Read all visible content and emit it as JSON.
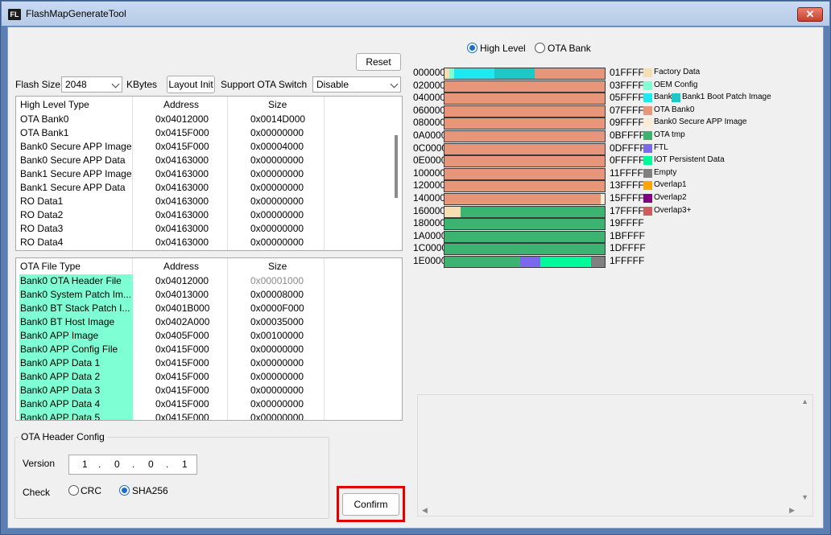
{
  "window": {
    "title": "FlashMapGenerateTool",
    "icon_text": "FL",
    "close_label": "✕"
  },
  "toolbar": {
    "reset_label": "Reset",
    "flash_size_label": "Flash Size",
    "flash_size_value": "2048",
    "kbytes_label": "KBytes",
    "layout_init_label": "Layout Init",
    "ota_switch_label": "Support OTA Switch",
    "ota_switch_value": "Disable"
  },
  "high_level_table": {
    "headers": [
      "High Level Type",
      "Address",
      "Size"
    ],
    "rows": [
      [
        "OTA Bank0",
        "0x04012000",
        "0x0014D000"
      ],
      [
        "OTA Bank1",
        "0x0415F000",
        "0x00000000"
      ],
      [
        "Bank0 Secure APP Image",
        "0x0415F000",
        "0x00004000"
      ],
      [
        "Bank0 Secure APP Data",
        "0x04163000",
        "0x00000000"
      ],
      [
        "Bank1 Secure APP Image",
        "0x04163000",
        "0x00000000"
      ],
      [
        "Bank1 Secure APP Data",
        "0x04163000",
        "0x00000000"
      ],
      [
        "RO Data1",
        "0x04163000",
        "0x00000000"
      ],
      [
        "RO Data2",
        "0x04163000",
        "0x00000000"
      ],
      [
        "RO Data3",
        "0x04163000",
        "0x00000000"
      ],
      [
        "RO Data4",
        "0x04163000",
        "0x00000000"
      ]
    ]
  },
  "ota_file_table": {
    "headers": [
      "OTA File Type",
      "Address",
      "Size"
    ],
    "rows": [
      [
        "Bank0 OTA Header File",
        "0x04012000",
        "0x00001000"
      ],
      [
        "Bank0 System Patch Im...",
        "0x04013000",
        "0x00008000"
      ],
      [
        "Bank0 BT Stack Patch I...",
        "0x0401B000",
        "0x0000F000"
      ],
      [
        "Bank0 BT Host Image",
        "0x0402A000",
        "0x00035000"
      ],
      [
        "Bank0 APP Image",
        "0x0405F000",
        "0x00100000"
      ],
      [
        "Bank0 APP Config File",
        "0x0415F000",
        "0x00000000"
      ],
      [
        "Bank0 APP Data 1",
        "0x0415F000",
        "0x00000000"
      ],
      [
        "Bank0 APP Data 2",
        "0x0415F000",
        "0x00000000"
      ],
      [
        "Bank0 APP Data 3",
        "0x0415F000",
        "0x00000000"
      ],
      [
        "Bank0 APP Data 4",
        "0x0415F000",
        "0x00000000"
      ],
      [
        "Bank0 APP Data 5",
        "0x0415F000",
        "0x00000000"
      ]
    ]
  },
  "ota_header": {
    "group_title": "OTA Header Config",
    "version_label": "Version",
    "version_parts": [
      "1",
      ".",
      "0",
      ".",
      "0",
      ".",
      "1"
    ],
    "check_label": "Check",
    "crc_label": "CRC",
    "sha_label": "SHA256",
    "selected": "SHA256"
  },
  "confirm_label": "Confirm",
  "view_mode": {
    "high_level_label": "High Level",
    "ota_bank_label": "OTA Bank",
    "selected": "High Level"
  },
  "flash_map": {
    "left_addrs": [
      "000000",
      "020000",
      "040000",
      "060000",
      "080000",
      "0A0000",
      "0C0000",
      "0E0000",
      "100000",
      "120000",
      "140000",
      "160000",
      "180000",
      "1A0000",
      "1C0000",
      "1E0000"
    ],
    "right_addrs": [
      "01FFFF",
      "03FFFF",
      "05FFFF",
      "07FFFF",
      "09FFFF",
      "0BFFFF",
      "0DFFFF",
      "0FFFFF",
      "11FFFF",
      "13FFFF",
      "15FFFF",
      "17FFFF",
      "19FFFF",
      "1BFFFF",
      "1DFFFF",
      "1FFFFF"
    ]
  },
  "legend": [
    {
      "label": "Factory Data",
      "color": "#f5deb3"
    },
    {
      "label": "OEM Config",
      "color": "#7fffd4"
    },
    {
      "label": "Bank",
      "color": "#1ee8f0",
      "extra_label": "Bank1 Boot Patch Image",
      "extra_color": "#1ec8c8"
    },
    {
      "label": "OTA Bank0",
      "color": "#e8967a"
    },
    {
      "label": "Bank0 Secure APP Image",
      "color": "#faebd7"
    },
    {
      "label": "OTA tmp",
      "color": "#3cb371"
    },
    {
      "label": "FTL",
      "color": "#7b68ee"
    },
    {
      "label": "IOT Persistent Data",
      "color": "#00fa9a"
    },
    {
      "label": "Empty",
      "color": "#808080"
    },
    {
      "label": "Overlap1",
      "color": "#ffa500"
    },
    {
      "label": "Overlap2",
      "color": "#800080"
    },
    {
      "label": "Overlap3+",
      "color": "#cd5c5c"
    }
  ]
}
